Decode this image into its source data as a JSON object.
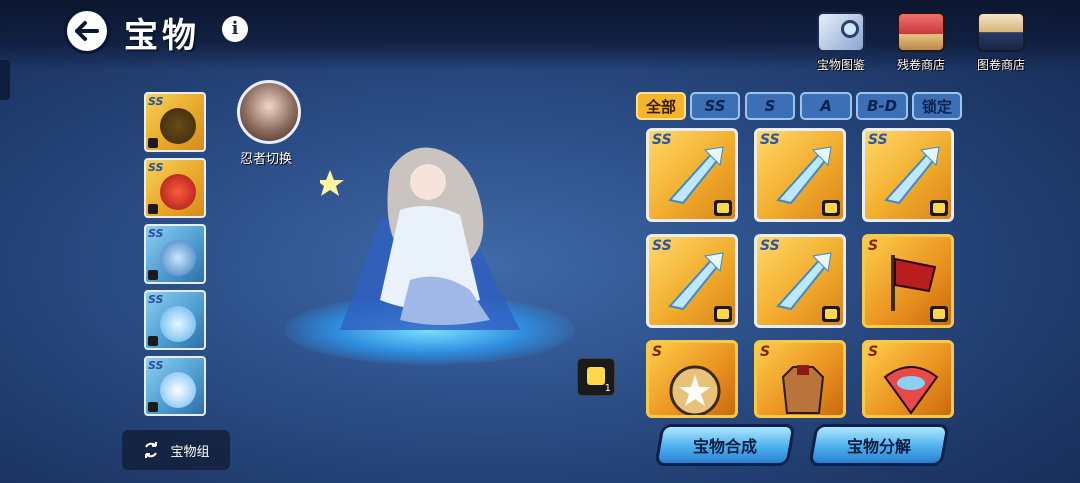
{
  "header": {
    "title": "宝物",
    "info_glyph": "i",
    "shops": [
      {
        "label": "宝物图鉴",
        "icon": "book-magnifier-icon"
      },
      {
        "label": "残卷商店",
        "icon": "shop-stall-icon"
      },
      {
        "label": "图卷商店",
        "icon": "scroll-shop-icon"
      }
    ]
  },
  "left_slots": [
    {
      "rank": "SS",
      "icon": "gourd-treasure-icon",
      "locked": true
    },
    {
      "rank": "SS",
      "icon": "red-mask-treasure-icon",
      "locked": true
    },
    {
      "rank": "SS",
      "icon": "blue-crown-treasure-icon",
      "locked": true
    },
    {
      "rank": "SS",
      "icon": "ice-trident-treasure-icon",
      "locked": true
    },
    {
      "rank": "SS",
      "icon": "wing-treasure-icon",
      "locked": true
    }
  ],
  "bundle_button": "宝物组",
  "ninja_switch_label": "忍者切换",
  "filter_tabs": [
    {
      "label": "全部",
      "active": true
    },
    {
      "label": "SS",
      "active": false
    },
    {
      "label": "S",
      "active": false
    },
    {
      "label": "A",
      "active": false
    },
    {
      "label": "B-D",
      "active": false
    },
    {
      "label": "锁定",
      "active": false
    }
  ],
  "grid": [
    {
      "rank": "SS",
      "icon": "ice-trident-icon"
    },
    {
      "rank": "SS",
      "icon": "ice-trident-icon"
    },
    {
      "rank": "SS",
      "icon": "ice-trident-icon"
    },
    {
      "rank": "SS",
      "icon": "ice-trident-icon"
    },
    {
      "rank": "SS",
      "icon": "ice-trident-icon"
    },
    {
      "rank": "S",
      "icon": "war-banner-icon"
    },
    {
      "rank": "S",
      "icon": "star-drum-icon"
    },
    {
      "rank": "S",
      "icon": "armor-icon"
    },
    {
      "rank": "S",
      "icon": "fish-fan-icon"
    }
  ],
  "shirt_counter": "1",
  "actions": {
    "synthesize": "宝物合成",
    "decompose": "宝物分解"
  },
  "colors": {
    "gold": "#f3b52a",
    "tab_blue": "#3b6fb6",
    "button_blue": "#4cb0ee"
  }
}
